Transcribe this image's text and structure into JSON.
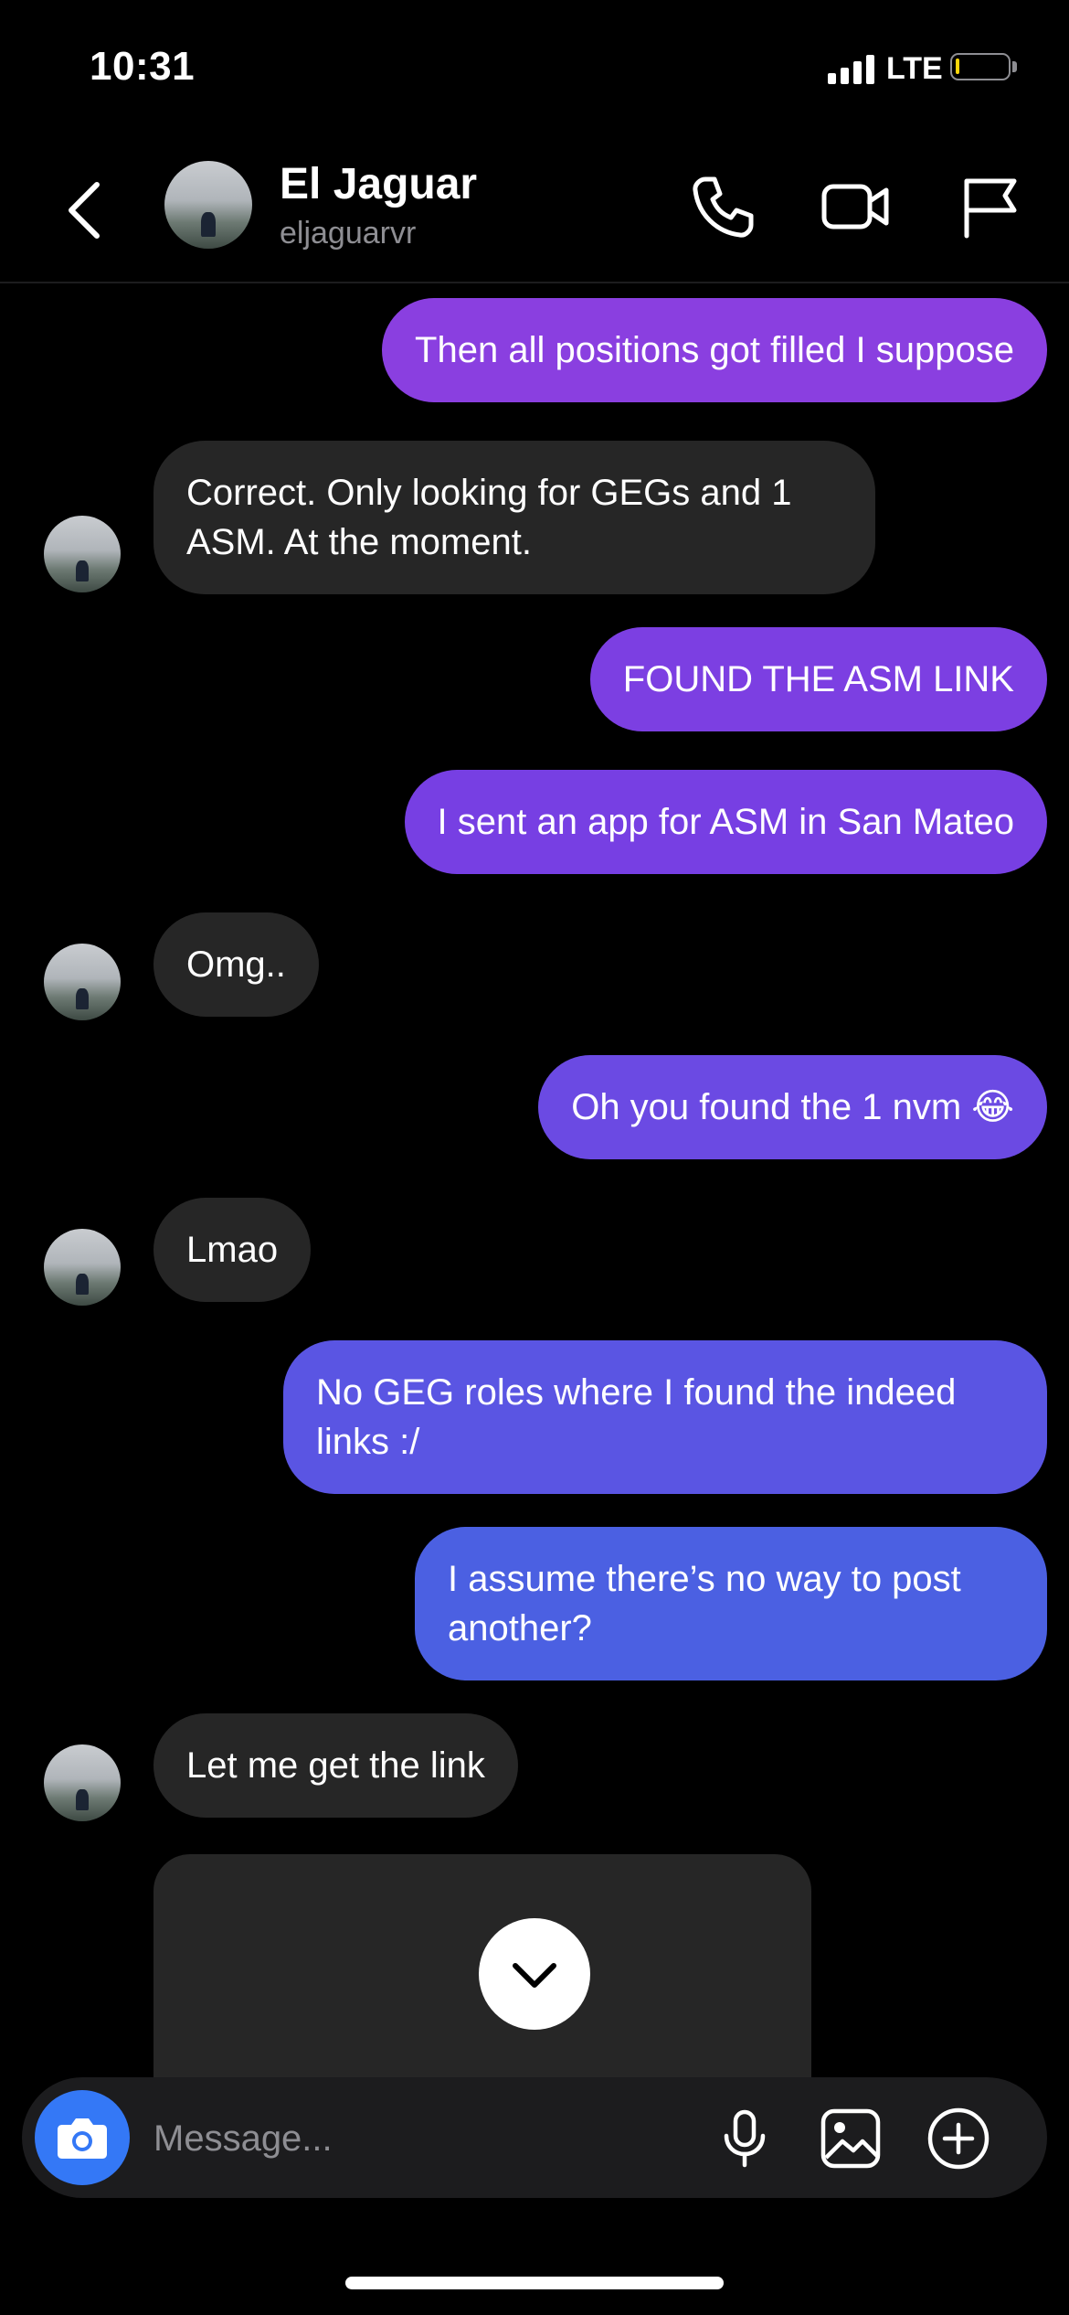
{
  "status_bar": {
    "time": "10:31",
    "network": "LTE",
    "battery_color": "#ffd60a"
  },
  "header": {
    "name": "El Jaguar",
    "handle": "eljaguarvr",
    "icons": [
      "back-icon",
      "phone-icon",
      "video-call-icon",
      "flag-icon"
    ]
  },
  "messages": [
    {
      "from": "me",
      "text": "Then all positions got filled I suppose",
      "color": "#8a3fe0"
    },
    {
      "from": "them",
      "text": "Correct. Only looking for GEGs and 1 ASM. At the moment."
    },
    {
      "from": "me",
      "text": "FOUND THE ASM LINK",
      "color": "#7c3fe2"
    },
    {
      "from": "me",
      "text": "I sent an app for ASM in San Mateo",
      "color": "#773fe3"
    },
    {
      "from": "them",
      "text": "Omg.."
    },
    {
      "from": "me",
      "text": "Oh you found the 1 nvm 😂",
      "color": "#6b4ae3"
    },
    {
      "from": "them",
      "text": "Lmao"
    },
    {
      "from": "me",
      "text": "No GEG roles where I found the indeed links :/",
      "color": "#5a55e3"
    },
    {
      "from": "me",
      "text": "I assume there’s no way to post another?",
      "color": "#4b60e2"
    },
    {
      "from": "them",
      "text": "Let me get the link"
    }
  ],
  "scroll_button_icon": "chevron-down-icon",
  "composer": {
    "placeholder": "Message...",
    "camera_color": "#3478f6",
    "icons": [
      "camera-icon",
      "microphone-icon",
      "gallery-icon",
      "add-icon"
    ]
  }
}
